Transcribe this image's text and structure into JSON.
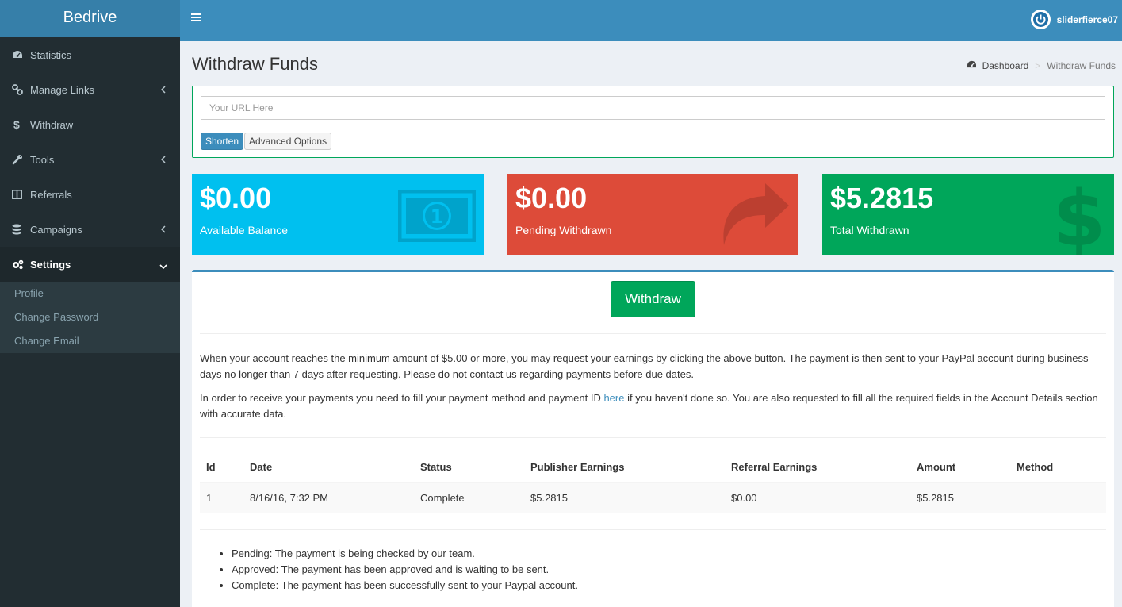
{
  "app": {
    "title": "Bedrive"
  },
  "sidebar": {
    "items": [
      {
        "label": "Statistics",
        "icon": "dashboard-icon"
      },
      {
        "label": "Manage Links",
        "icon": "link-icon"
      },
      {
        "label": "Withdraw",
        "icon": "dollar-icon"
      },
      {
        "label": "Tools",
        "icon": "wrench-icon"
      },
      {
        "label": "Referrals",
        "icon": "columns-icon"
      },
      {
        "label": "Campaigns",
        "icon": "database-icon"
      },
      {
        "label": "Settings",
        "icon": "cogs-icon"
      }
    ],
    "submenu": [
      "Profile",
      "Change Password",
      "Change Email"
    ]
  },
  "header": {
    "username": "sliderfierce07"
  },
  "page": {
    "title": "Withdraw Funds"
  },
  "breadcrumb": {
    "home": "Dashboard",
    "current": "Withdraw Funds"
  },
  "shorten": {
    "placeholder": "Your URL Here",
    "shorten_label": "Shorten",
    "advanced_label": "Advanced Options"
  },
  "stats": {
    "available": {
      "amount": "$0.00",
      "label": "Available Balance",
      "color": "#00c0ef"
    },
    "pending": {
      "amount": "$0.00",
      "label": "Pending Withdrawn",
      "color": "#dd4b39"
    },
    "total": {
      "amount": "$5.2815",
      "label": "Total Withdrawn",
      "color": "#00a65a"
    }
  },
  "withdraw": {
    "button_label": "Withdraw",
    "para1": "When your account reaches the minimum amount of $5.00 or more, you may request your earnings by clicking the above button. The payment is then sent to your PayPal account during business days no longer than 7 days after requesting. Please do not contact us regarding payments before due dates.",
    "para2_before": "In order to receive your payments you need to fill your payment method and payment ID ",
    "para2_link": "here",
    "para2_after": " if you haven't done so. You are also requested to fill all the required fields in the Account Details section with accurate data."
  },
  "table": {
    "headers": [
      "Id",
      "Date",
      "Status",
      "Publisher Earnings",
      "Referral Earnings",
      "Amount",
      "Method"
    ],
    "rows": [
      [
        "1",
        "8/16/16, 7:32 PM",
        "Complete",
        "$5.2815",
        "$0.00",
        "$5.2815",
        ""
      ]
    ]
  },
  "legend": [
    "Pending: The payment is being checked by our team.",
    "Approved: The payment has been approved and is waiting to be sent.",
    "Complete: The payment has been successfully sent to your Paypal account."
  ]
}
